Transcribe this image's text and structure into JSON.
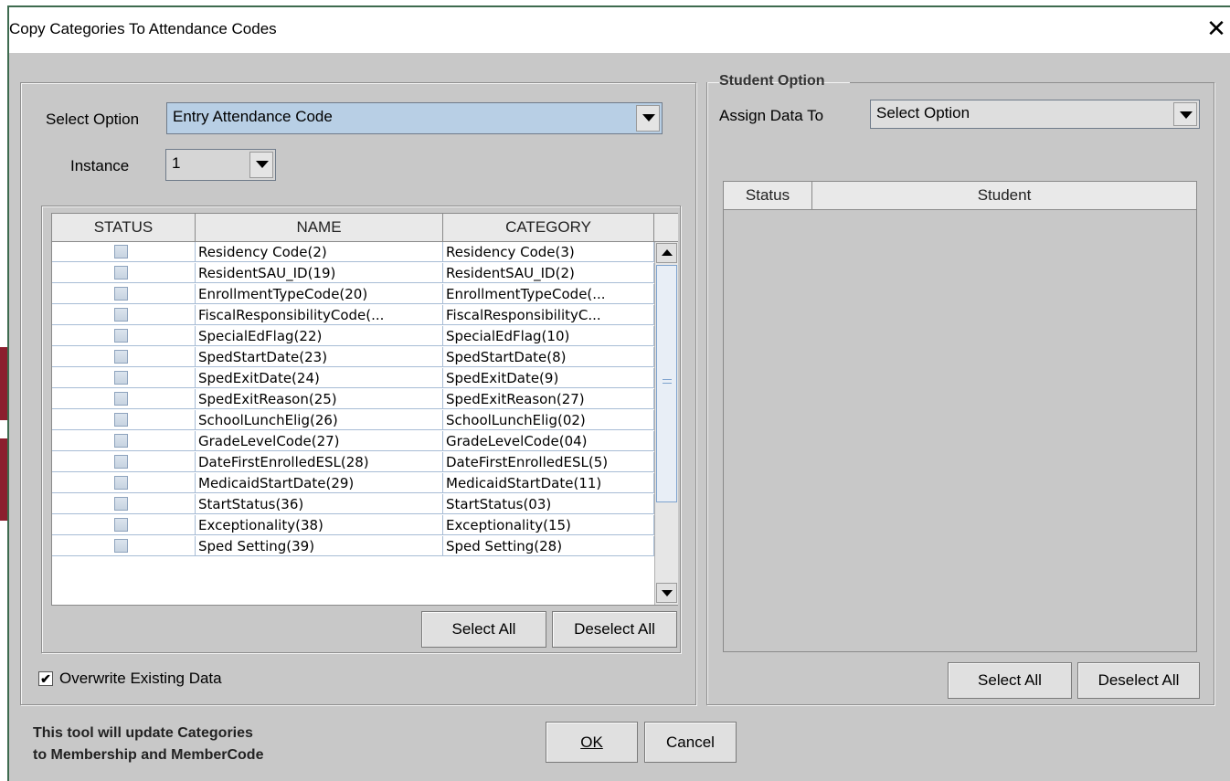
{
  "window": {
    "title": "Copy Categories To Attendance Codes",
    "close_glyph": "✕"
  },
  "left": {
    "select_option": {
      "label": "Select Option",
      "value": "Entry Attendance Code"
    },
    "instance": {
      "label": "Instance",
      "value": "1"
    },
    "table": {
      "headers": [
        "STATUS",
        "NAME",
        "CATEGORY"
      ],
      "rows": [
        {
          "name": "Residency Code(2)",
          "category": "Residency Code(3)"
        },
        {
          "name": "ResidentSAU_ID(19)",
          "category": "ResidentSAU_ID(2)"
        },
        {
          "name": "EnrollmentTypeCode(20)",
          "category": "EnrollmentTypeCode(..."
        },
        {
          "name": "FiscalResponsibilityCode(...",
          "category": "FiscalResponsibilityC..."
        },
        {
          "name": "SpecialEdFlag(22)",
          "category": "SpecialEdFlag(10)"
        },
        {
          "name": "SpedStartDate(23)",
          "category": "SpedStartDate(8)"
        },
        {
          "name": "SpedExitDate(24)",
          "category": "SpedExitDate(9)"
        },
        {
          "name": "SpedExitReason(25)",
          "category": "SpedExitReason(27)"
        },
        {
          "name": "SchoolLunchElig(26)",
          "category": "SchoolLunchElig(02)"
        },
        {
          "name": "GradeLevelCode(27)",
          "category": "GradeLevelCode(04)"
        },
        {
          "name": "DateFirstEnrolledESL(28)",
          "category": "DateFirstEnrolledESL(5)"
        },
        {
          "name": "MedicaidStartDate(29)",
          "category": "MedicaidStartDate(11)"
        },
        {
          "name": "StartStatus(36)",
          "category": "StartStatus(03)"
        },
        {
          "name": "Exceptionality(38)",
          "category": "Exceptionality(15)"
        },
        {
          "name": "Sped Setting(39)",
          "category": "Sped Setting(28)"
        }
      ]
    },
    "select_all": "Select All",
    "deselect_all": "Deselect All",
    "overwrite": {
      "label": "Overwrite Existing Data",
      "checked": true,
      "mark": "✔"
    }
  },
  "right": {
    "group_title": "Student Option",
    "assign": {
      "label": "Assign Data To",
      "value": "Select Option"
    },
    "table": {
      "headers": [
        "Status",
        "Student"
      ]
    },
    "select_all": "Select All",
    "deselect_all": "Deselect All"
  },
  "footer": {
    "info_line1": "This tool will update Categories",
    "info_line2": "to Membership and MemberCode",
    "ok": "OK",
    "cancel": "Cancel"
  }
}
